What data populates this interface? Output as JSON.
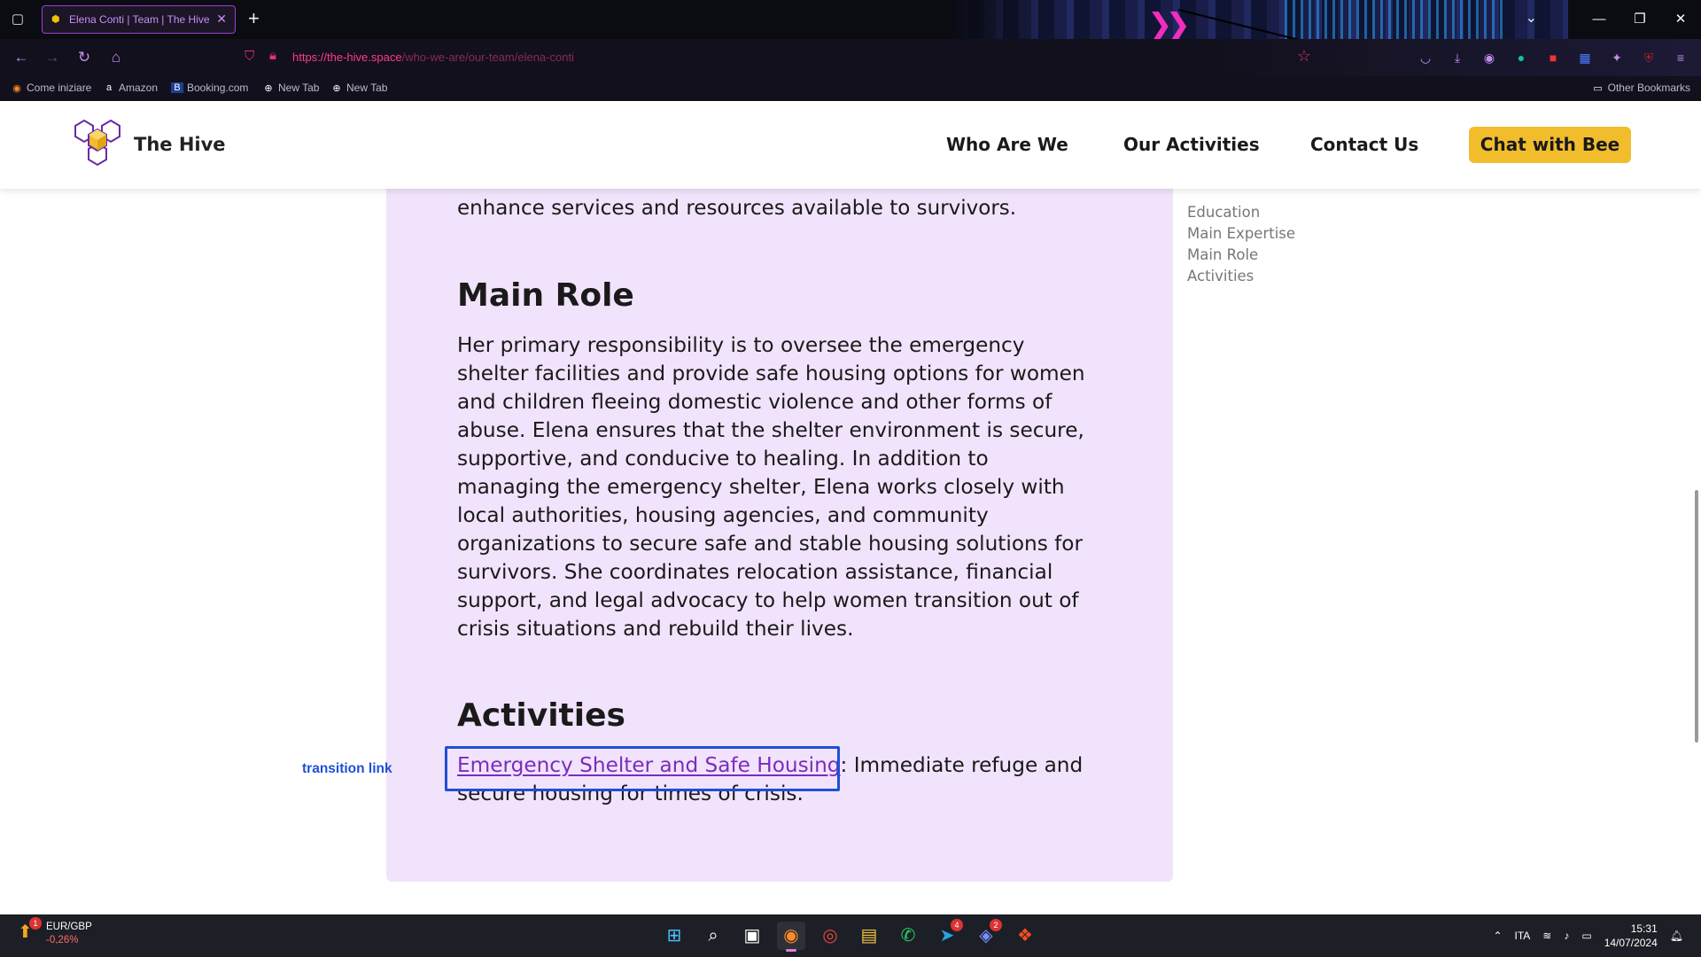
{
  "browser": {
    "tab_title": "Elena Conti | Team | The Hive",
    "url_host": "https://the-hive.space",
    "url_path": "/who-we-are/our-team/elena-conti",
    "bookmarks": [
      {
        "label": "Come iniziare",
        "icon": "firefox-icon"
      },
      {
        "label": "Amazon",
        "icon": "amazon-icon"
      },
      {
        "label": "Booking.com",
        "icon": "booking-icon"
      },
      {
        "label": "New Tab",
        "icon": "globe-icon"
      },
      {
        "label": "New Tab",
        "icon": "globe-icon"
      }
    ],
    "other_bookmarks": "Other Bookmarks",
    "accent": "#c58cf0"
  },
  "site": {
    "brand": "The Hive",
    "nav": [
      "Who Are We",
      "Our Activities",
      "Contact Us"
    ],
    "cta": "Chat with Bee",
    "cta_color": "#f2bd2c",
    "accent": "#7b2cbf"
  },
  "content": {
    "prev_tail": "enhance services and resources available to survivors.",
    "main_role_heading": "Main Role",
    "main_role_text": "Her primary responsibility is to oversee the emergency shelter facilities and provide safe housing options for women and children fleeing domestic violence and other forms of abuse. Elena ensures that the shelter environment is secure, supportive, and conducive to healing.  In addition to managing the emergency shelter, Elena works closely with local authorities, housing agencies, and community organizations to secure safe and stable housing solutions for survivors. She coordinates relocation assistance, financial support, and legal advocacy to help women transition out of crisis situations and rebuild their lives.",
    "activities_heading": "Activities",
    "activity_link": "Emergency Shelter and Safe Housing",
    "activity_rest": ": Immediate refuge and secure housing for times of crisis."
  },
  "toc": [
    "Education",
    "Main Expertise",
    "Main Role",
    "Activities"
  ],
  "annotation": {
    "label": "transition link",
    "color": "#1f4fd6"
  },
  "taskbar": {
    "stock_pair": "EUR/GBP",
    "stock_change": "-0,26%",
    "stock_badge": "1",
    "apps": [
      {
        "name": "start-icon",
        "glyph": "⊞"
      },
      {
        "name": "search-icon",
        "glyph": "⌕"
      },
      {
        "name": "task-view-icon",
        "glyph": "▣"
      },
      {
        "name": "firefox-icon",
        "glyph": "◉"
      },
      {
        "name": "chrome-icon",
        "glyph": "◎"
      },
      {
        "name": "file-explorer-icon",
        "glyph": "▤"
      },
      {
        "name": "whatsapp-icon",
        "glyph": "✆"
      },
      {
        "name": "telegram-icon",
        "glyph": "➤"
      },
      {
        "name": "discord-icon",
        "glyph": "◈"
      },
      {
        "name": "figma-icon",
        "glyph": "❖"
      }
    ],
    "telegram_count": "4",
    "discord_count": "2",
    "language": "ITA",
    "time": "15:31",
    "date": "14/07/2024"
  }
}
